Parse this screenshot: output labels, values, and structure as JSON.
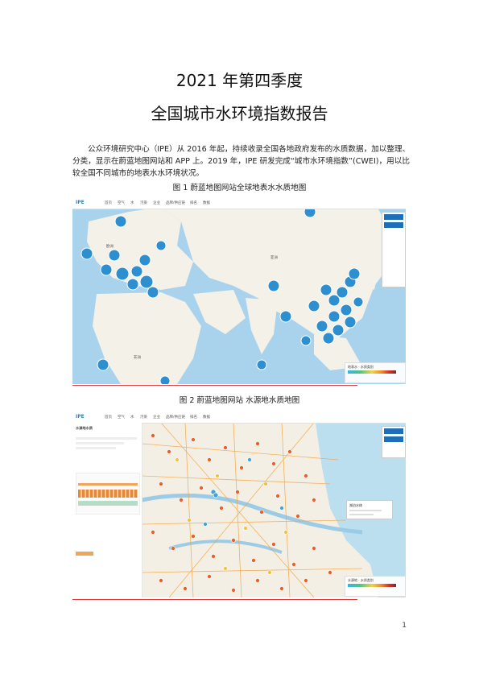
{
  "header": {
    "title_line1": "2021 年第四季度",
    "title_line2": "全国城市水环境指数报告"
  },
  "intro": {
    "paragraph": "公众环境研究中心（IPE）从 2016 年起，持续收录全国各地政府发布的水质数据，加以整理、分类，显示在蔚蓝地图网站和 APP 上。2019 年，IPE 研发完成“城市水环境指数”(CWEI)，用以比较全国不同城市的地表水水环境状况。"
  },
  "figures": [
    {
      "caption": "图 1 蔚蓝地图网站全球地表水水质地图"
    },
    {
      "caption": "图 2 蔚蓝地图网站 水源地水质地图"
    }
  ],
  "map1": {
    "logo": "IPE",
    "nav_items": [
      "首页",
      "空气",
      "水",
      "污染",
      "企业",
      "品牌/供应链",
      "排名",
      "数据"
    ],
    "map_labels": [
      "亚洲",
      "欧洲",
      "非洲"
    ],
    "legend_title": "地表水 · 水质类别",
    "colors": {
      "sea": "#a9d3ec",
      "land": "#f3f1e8",
      "cluster": "#2d8fcf",
      "accent": "#1f6fb8"
    }
  },
  "map2": {
    "logo": "IPE",
    "nav_items": [
      "首页",
      "空气",
      "水",
      "污染",
      "企业",
      "品牌/供应链",
      "排名",
      "数据"
    ],
    "sidebar_title": "水源地水质",
    "popup_title": "湖泊水体",
    "legend_title": "水源地 · 水质类别"
  },
  "footer": {
    "page_number": "1"
  }
}
